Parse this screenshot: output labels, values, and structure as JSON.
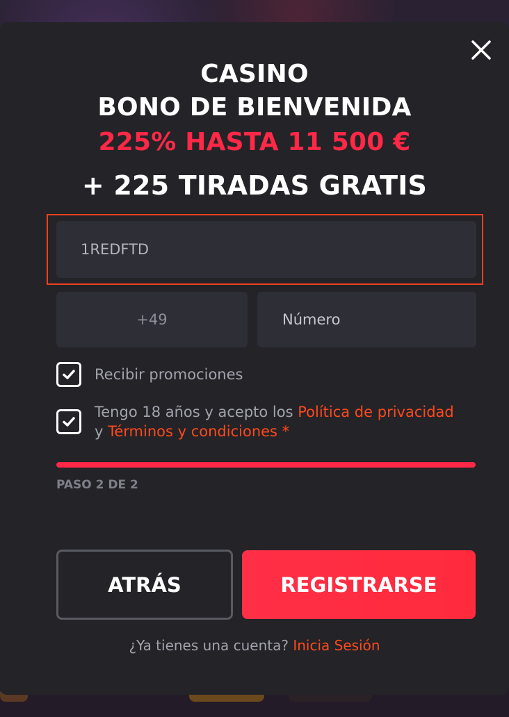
{
  "modal": {
    "headline_line1": "CASINO",
    "headline_line2": "BONO DE BIENVENIDA",
    "headline_offer": "225% HASTA 11 500 €",
    "headline_spins": "+ 225 TIRADAS GRATIS"
  },
  "form": {
    "promo_code_value": "1REDFTD",
    "phone_prefix_value": "+49",
    "phone_number_placeholder": "Número",
    "checkbox_promotions": {
      "checked": true,
      "label": "Recibir promociones"
    },
    "checkbox_terms": {
      "checked": true,
      "label_prefix": "Tengo 18 años y acepto los ",
      "privacy_link": "Política de privacidad",
      "conjunction": " y ",
      "terms_link": "Términos y condiciones",
      "required_mark": " *"
    }
  },
  "progress": {
    "fraction": 1.0,
    "step_label": "PASO 2 DE 2"
  },
  "buttons": {
    "back_label": "ATRÁS",
    "register_label": "REGISTRARSE"
  },
  "footer": {
    "question": "¿Ya tienes una cuenta? ",
    "login_link": "Inicia Sesión"
  },
  "colors": {
    "accent": "#ff2846",
    "link": "#ff4a1c",
    "modal_bg": "#232328",
    "field_bg": "#2d2e36"
  },
  "icons": {
    "close": "close-icon",
    "checkmark": "checkmark-icon"
  }
}
